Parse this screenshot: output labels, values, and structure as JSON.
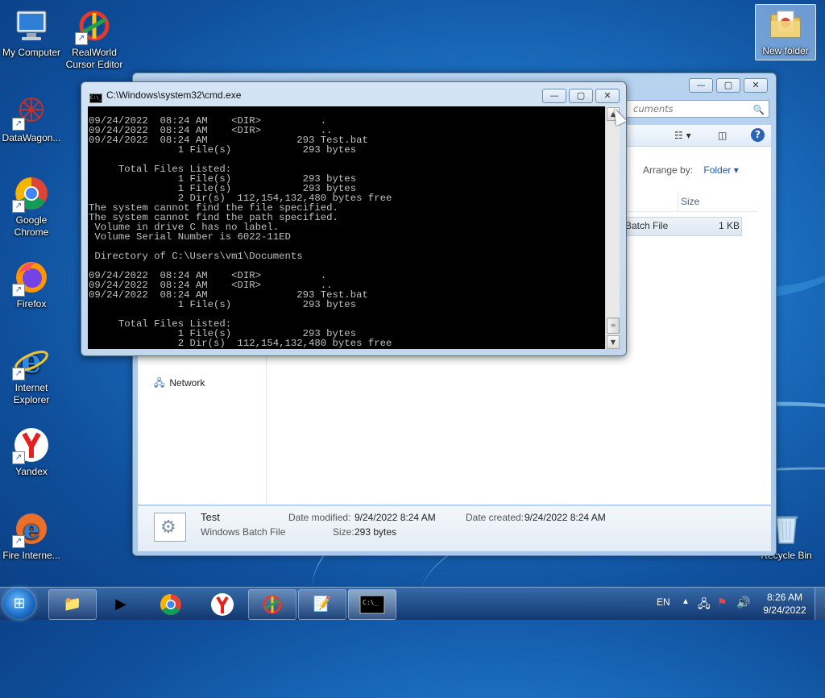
{
  "desktop": {
    "icons": [
      {
        "label": "My Computer",
        "icon": "computer-icon"
      },
      {
        "label": "RealWorld Cursor Editor",
        "icon": "cursor-editor-icon"
      },
      {
        "label": "DataWagon...",
        "icon": "datawagon-icon"
      },
      {
        "label": "Google Chrome",
        "icon": "chrome-icon"
      },
      {
        "label": "Firefox",
        "icon": "firefox-icon"
      },
      {
        "label": "Internet Explorer",
        "icon": "internet-explorer-icon"
      },
      {
        "label": "Yandex",
        "icon": "yandex-icon"
      },
      {
        "label": "Fire Interne...",
        "icon": "fire-internet-icon"
      },
      {
        "label": "New folder",
        "icon": "folder-icon"
      },
      {
        "label": "Recycle Bin",
        "icon": "recycle-bin-icon"
      }
    ]
  },
  "explorer": {
    "search_placeholder": "Search Documents",
    "search_visible": "cuments",
    "arrange_label": "Arrange by:",
    "arrange_value": "Folder",
    "column_size": "Size",
    "file_row": {
      "name": "Batch File",
      "size": "1 KB"
    },
    "nav_network": "Network",
    "details": {
      "name": "Test",
      "type": "Windows Batch File",
      "modified_label": "Date modified:",
      "modified_value": "9/24/2022 8:24 AM",
      "size_label": "Size:",
      "size_value": "293 bytes",
      "created_label": "Date created:",
      "created_value": "9/24/2022 8:24 AM"
    }
  },
  "cmd": {
    "title": "C:\\Windows\\system32\\cmd.exe",
    "icon_text": "C:\\_",
    "lines": "09/24/2022  08:24 AM    <DIR>          .\n09/24/2022  08:24 AM    <DIR>          ..\n09/24/2022  08:24 AM               293 Test.bat\n               1 File(s)            293 bytes\n\n     Total Files Listed:\n               1 File(s)            293 bytes\n               1 File(s)            293 bytes\n               2 Dir(s)  112,154,132,480 bytes free\nThe system cannot find the file specified.\nThe system cannot find the path specified.\n Volume in drive C has no label.\n Volume Serial Number is 6022-11ED\n\n Directory of C:\\Users\\vm1\\Documents\n\n09/24/2022  08:24 AM    <DIR>          .\n09/24/2022  08:24 AM    <DIR>          ..\n09/24/2022  08:24 AM               293 Test.bat\n               1 File(s)            293 bytes\n\n     Total Files Listed:\n               1 File(s)            293 bytes\n               2 Dir(s)  112,154,132,480 bytes free"
  },
  "taskbar": {
    "items": [
      {
        "name": "explorer",
        "icon": "folder-icon"
      },
      {
        "name": "media-player",
        "icon": "media-player-icon"
      },
      {
        "name": "chrome",
        "icon": "chrome-icon"
      },
      {
        "name": "yandex",
        "icon": "yandex-icon"
      },
      {
        "name": "cursor-editor",
        "icon": "cursor-editor-icon"
      },
      {
        "name": "notepad",
        "icon": "notepad-icon"
      },
      {
        "name": "cmd",
        "icon": "cmd-icon"
      }
    ],
    "language": "EN",
    "time": "8:26 AM",
    "date": "9/24/2022"
  }
}
